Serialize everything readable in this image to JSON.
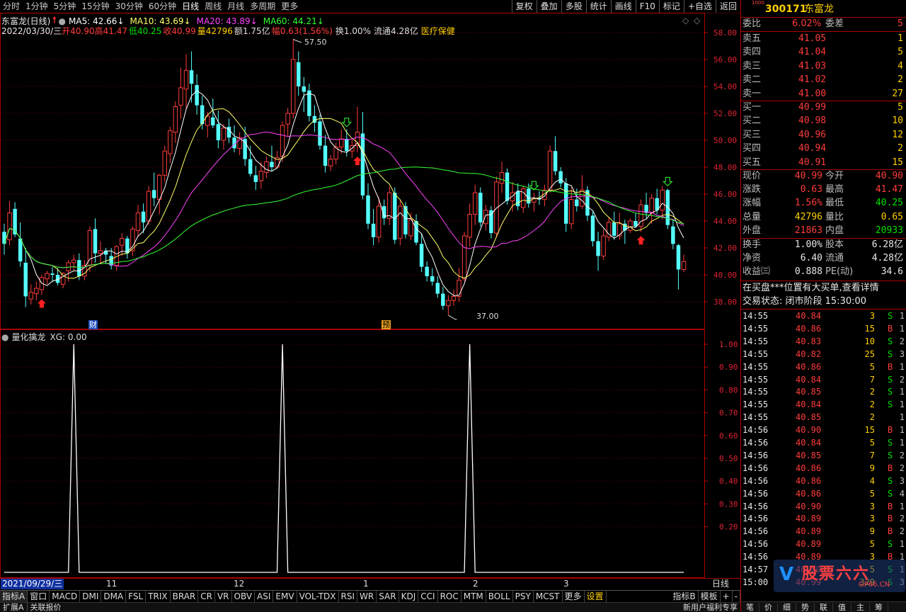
{
  "toolbar": {
    "periods": [
      "分时",
      "1分钟",
      "5分钟",
      "15分钟",
      "30分钟",
      "60分钟",
      "日线",
      "周线",
      "月线",
      "多周期",
      "更多"
    ],
    "active_period": "日线",
    "right_buttons": [
      "复权",
      "叠加",
      "多股",
      "统计",
      "画线",
      "F10",
      "标记",
      "+自选",
      "返回"
    ]
  },
  "stock": {
    "title": "东富龙(日线)",
    "code": "300171",
    "name": "东富龙",
    "code_badge": "1000"
  },
  "ma": {
    "ma5": "MA5: 42.66",
    "ma10": "MA10: 43.69",
    "ma20": "MA20: 43.89",
    "ma60": "MA60: 44.21",
    "colors": {
      "ma5": "#ffffff",
      "ma10": "#ffff66",
      "ma20": "#ff44ff",
      "ma60": "#33ff33"
    }
  },
  "bar_info": {
    "date": "2022/03/30/三",
    "open_label": "开",
    "open": "40.90",
    "high_label": "高",
    "high": "41.47",
    "low_label": "低",
    "low": "40.25",
    "close_label": "收",
    "close": "40.99",
    "volume_label": "量",
    "volume": "42796",
    "amount_label": "额",
    "amount": "1.75亿",
    "change_label": "幅",
    "change": "0.63(1.56%)",
    "turnover": "换1.00%",
    "float": "流通4.28亿",
    "sector": "医疗保健"
  },
  "price_axis": [
    "58.00",
    "56.00",
    "54.00",
    "52.00",
    "50.00",
    "48.00",
    "46.00",
    "44.00",
    "42.00",
    "40.00",
    "38.00"
  ],
  "annotations": {
    "high_mark": "57.50",
    "low_mark": "37.00",
    "fin_badge": "财",
    "pre_badge": "预"
  },
  "indicator": {
    "title": "量化擒龙",
    "value_label": "XG: 0.00",
    "axis": [
      "1.00",
      "0.90",
      "0.80",
      "0.70",
      "0.60",
      "0.50",
      "0.40",
      "0.30",
      "0.20"
    ]
  },
  "x_axis": {
    "start_date": "2021/09/29/三",
    "months": [
      "11",
      "12",
      "1",
      "2",
      "3"
    ],
    "period_label": "日线"
  },
  "indicator_tabs": [
    "指标A",
    "窗口",
    "MACD",
    "DMI",
    "DMA",
    "FSL",
    "TRIX",
    "BRAR",
    "CR",
    "VR",
    "OBV",
    "ASI",
    "EMV",
    "VOL-TDX",
    "RSI",
    "WR",
    "SAR",
    "KDJ",
    "CCI",
    "ROC",
    "MTM",
    "BOLL",
    "PSY",
    "MCST",
    "更多",
    "设置"
  ],
  "right_tabs": [
    "指标B",
    "模板",
    "+",
    "-"
  ],
  "quote": {
    "weibi_label": "委比",
    "weibi": "6.02%",
    "weicha_label": "委差",
    "weicha": "5",
    "sell": [
      {
        "label": "卖五",
        "price": "41.05",
        "vol": "1"
      },
      {
        "label": "卖四",
        "price": "41.04",
        "vol": "5"
      },
      {
        "label": "卖三",
        "price": "41.03",
        "vol": "4"
      },
      {
        "label": "卖二",
        "price": "41.02",
        "vol": "2"
      },
      {
        "label": "卖一",
        "price": "41.00",
        "vol": "27"
      }
    ],
    "buy": [
      {
        "label": "买一",
        "price": "40.99",
        "vol": "5"
      },
      {
        "label": "买二",
        "price": "40.98",
        "vol": "10"
      },
      {
        "label": "买三",
        "price": "40.96",
        "vol": "12"
      },
      {
        "label": "买四",
        "price": "40.94",
        "vol": "2"
      },
      {
        "label": "买五",
        "price": "40.91",
        "vol": "15"
      }
    ],
    "stats": [
      {
        "l1": "现价",
        "v1": "40.99",
        "l2": "今开",
        "v2": "40.90",
        "c1": "red",
        "c2": "red"
      },
      {
        "l1": "涨跌",
        "v1": "0.63",
        "l2": "最高",
        "v2": "41.47",
        "c1": "red",
        "c2": "red"
      },
      {
        "l1": "涨幅",
        "v1": "1.56%",
        "l2": "最低",
        "v2": "40.25",
        "c1": "red",
        "c2": "green"
      },
      {
        "l1": "总量",
        "v1": "42796",
        "l2": "量比",
        "v2": "0.65",
        "c1": "yellow",
        "c2": "yellow"
      },
      {
        "l1": "外盘",
        "v1": "21863",
        "l2": "内盘",
        "v2": "20933",
        "c1": "red",
        "c2": "green"
      }
    ],
    "stats2": [
      {
        "l1": "换手",
        "v1": "1.00%",
        "l2": "股本",
        "v2": "6.28亿"
      },
      {
        "l1": "净资",
        "v1": "6.40",
        "l2": "流通",
        "v2": "4.28亿"
      },
      {
        "l1": "收益㈢",
        "v1": "0.888",
        "l2": "PE(动)",
        "v2": "34.6"
      }
    ],
    "notice": "在买盘***位置有大买单,查看详情",
    "trade_status": "交易状态: 闭市阶段 15:30:00"
  },
  "ticks": [
    {
      "t": "14:55",
      "p": "40.84",
      "v": "3",
      "s": "S",
      "n": "1"
    },
    {
      "t": "14:55",
      "p": "40.86",
      "v": "15",
      "s": "B",
      "n": "1"
    },
    {
      "t": "14:55",
      "p": "40.83",
      "v": "10",
      "s": "S",
      "n": "2"
    },
    {
      "t": "14:55",
      "p": "40.82",
      "v": "25",
      "s": "S",
      "n": "3"
    },
    {
      "t": "14:55",
      "p": "40.86",
      "v": "5",
      "s": "B",
      "n": "1"
    },
    {
      "t": "14:55",
      "p": "40.84",
      "v": "7",
      "s": "S",
      "n": "2"
    },
    {
      "t": "14:55",
      "p": "40.85",
      "v": "2",
      "s": "S",
      "n": "1"
    },
    {
      "t": "14:55",
      "p": "40.84",
      "v": "2",
      "s": "S",
      "n": "1"
    },
    {
      "t": "14:55",
      "p": "40.85",
      "v": "2",
      "s": "",
      "n": "1"
    },
    {
      "t": "14:56",
      "p": "40.90",
      "v": "15",
      "s": "B",
      "n": "1"
    },
    {
      "t": "14:56",
      "p": "40.84",
      "v": "5",
      "s": "S",
      "n": "1"
    },
    {
      "t": "14:56",
      "p": "40.85",
      "v": "7",
      "s": "S",
      "n": "2"
    },
    {
      "t": "14:56",
      "p": "40.86",
      "v": "9",
      "s": "B",
      "n": "2"
    },
    {
      "t": "14:56",
      "p": "40.86",
      "v": "4",
      "s": "S",
      "n": "3"
    },
    {
      "t": "14:56",
      "p": "40.86",
      "v": "5",
      "s": "S",
      "n": "4"
    },
    {
      "t": "14:56",
      "p": "40.90",
      "v": "3",
      "s": "B",
      "n": "1"
    },
    {
      "t": "14:56",
      "p": "40.89",
      "v": "3",
      "s": "B",
      "n": "2"
    },
    {
      "t": "14:56",
      "p": "40.89",
      "v": "9",
      "s": "B",
      "n": "2"
    },
    {
      "t": "14:56",
      "p": "40.89",
      "v": "5",
      "s": "S",
      "n": "1"
    },
    {
      "t": "14:56",
      "p": "40.89",
      "v": "3",
      "s": "B",
      "n": "1"
    },
    {
      "t": "14:57",
      "p": "40.89",
      "v": "5",
      "s": "S",
      "n": "1"
    },
    {
      "t": "15:00",
      "p": "40.99",
      "v": "329",
      "s": "S",
      "n": "3"
    }
  ],
  "watermark": "GP66.CN",
  "status_bar": {
    "left": [
      "扩展A",
      "关联报价"
    ],
    "right": "新用户福利专享"
  },
  "right_bottom_tabs": [
    "笔",
    "价",
    "细",
    "势",
    "联",
    "值",
    "主",
    "筹"
  ],
  "candles": [
    [
      43.2,
      43.8,
      41.5,
      42.3
    ],
    [
      42.6,
      45.5,
      42.2,
      44.6
    ],
    [
      44.9,
      45.4,
      42.8,
      43.0
    ],
    [
      42.7,
      43.9,
      40.6,
      41.0
    ],
    [
      40.9,
      42.0,
      37.6,
      38.4
    ],
    [
      38.2,
      39.3,
      37.8,
      38.7
    ],
    [
      38.6,
      39.5,
      38.1,
      39.0
    ],
    [
      38.9,
      40.0,
      38.5,
      39.8
    ],
    [
      39.7,
      40.3,
      39.3,
      40.1
    ],
    [
      40.1,
      40.6,
      39.5,
      40.0
    ],
    [
      40.0,
      40.5,
      39.2,
      39.4
    ],
    [
      39.3,
      40.2,
      39.0,
      40.1
    ],
    [
      40.3,
      41.1,
      39.5,
      40.9
    ],
    [
      40.9,
      41.5,
      40.3,
      41.1
    ],
    [
      41.1,
      41.6,
      39.6,
      39.9
    ],
    [
      39.9,
      41.1,
      39.6,
      40.7
    ],
    [
      40.7,
      43.6,
      40.2,
      43.3
    ],
    [
      43.4,
      44.2,
      40.9,
      41.6
    ],
    [
      41.6,
      42.5,
      40.8,
      41.8
    ],
    [
      41.8,
      42.0,
      40.8,
      41.5
    ],
    [
      41.4,
      42.0,
      40.4,
      40.7
    ],
    [
      40.7,
      42.2,
      40.3,
      42.1
    ],
    [
      42.2,
      43.1,
      41.4,
      42.7
    ],
    [
      42.7,
      42.9,
      41.2,
      41.6
    ],
    [
      41.8,
      43.6,
      41.4,
      43.4
    ],
    [
      43.3,
      45.2,
      42.8,
      44.6
    ],
    [
      44.7,
      45.3,
      43.1,
      43.9
    ],
    [
      44.0,
      46.6,
      43.7,
      46.2
    ],
    [
      46.3,
      47.6,
      45.1,
      45.7
    ],
    [
      45.6,
      47.5,
      44.5,
      47.4
    ],
    [
      47.4,
      49.6,
      46.9,
      49.2
    ],
    [
      49.0,
      51.0,
      48.3,
      50.7
    ],
    [
      50.6,
      52.9,
      49.8,
      52.5
    ],
    [
      52.6,
      55.4,
      51.6,
      53.9
    ],
    [
      53.8,
      56.4,
      52.3,
      55.2
    ],
    [
      55.2,
      56.6,
      52.8,
      54.2
    ],
    [
      54.1,
      54.9,
      51.9,
      52.6
    ],
    [
      52.6,
      53.3,
      50.8,
      51.2
    ],
    [
      51.1,
      52.1,
      50.2,
      51.8
    ],
    [
      51.7,
      53.1,
      50.9,
      51.1
    ],
    [
      51.2,
      52.2,
      49.4,
      50.0
    ],
    [
      50.0,
      51.2,
      49.3,
      50.9
    ],
    [
      51.0,
      51.6,
      49.8,
      50.2
    ],
    [
      50.2,
      51.1,
      49.1,
      49.4
    ],
    [
      49.4,
      50.6,
      48.9,
      50.2
    ],
    [
      50.1,
      51.0,
      48.1,
      48.6
    ],
    [
      48.6,
      49.6,
      47.3,
      47.5
    ],
    [
      47.4,
      48.1,
      46.3,
      46.9
    ],
    [
      47.0,
      48.4,
      46.4,
      47.7
    ],
    [
      47.6,
      48.8,
      47.2,
      48.4
    ],
    [
      48.4,
      49.6,
      47.7,
      48.0
    ],
    [
      48.0,
      49.2,
      47.9,
      48.7
    ],
    [
      48.8,
      51.4,
      48.4,
      51.1
    ],
    [
      51.2,
      52.4,
      50.3,
      52.0
    ],
    [
      52.0,
      57.5,
      51.6,
      56.0
    ],
    [
      55.8,
      56.6,
      53.3,
      54.0
    ],
    [
      54.0,
      54.7,
      52.1,
      53.6
    ],
    [
      53.7,
      54.2,
      51.4,
      51.8
    ],
    [
      51.8,
      52.6,
      50.6,
      51.3
    ],
    [
      51.4,
      51.9,
      49.3,
      49.6
    ],
    [
      49.6,
      50.4,
      47.6,
      48.1
    ],
    [
      48.1,
      48.9,
      47.7,
      48.6
    ],
    [
      48.6,
      49.8,
      48.2,
      49.5
    ],
    [
      49.5,
      50.8,
      49.0,
      50.1
    ],
    [
      50.1,
      50.8,
      48.8,
      49.2
    ],
    [
      49.2,
      50.0,
      48.7,
      49.6
    ],
    [
      49.6,
      52.5,
      49.1,
      50.6
    ],
    [
      50.5,
      52.1,
      45.6,
      45.9
    ],
    [
      45.9,
      46.8,
      43.4,
      43.8
    ],
    [
      43.8,
      44.9,
      42.2,
      42.8
    ],
    [
      42.8,
      45.8,
      42.4,
      45.1
    ],
    [
      45.1,
      45.6,
      43.7,
      44.2
    ],
    [
      44.2,
      46.6,
      43.7,
      46.1
    ],
    [
      46.1,
      46.5,
      42.3,
      42.6
    ],
    [
      42.7,
      45.6,
      42.2,
      45.1
    ],
    [
      45.1,
      45.4,
      42.7,
      43.0
    ],
    [
      42.9,
      44.6,
      42.6,
      44.1
    ],
    [
      44.0,
      44.5,
      42.2,
      42.4
    ],
    [
      42.3,
      43.1,
      40.2,
      40.6
    ],
    [
      40.6,
      41.0,
      39.5,
      39.9
    ],
    [
      39.9,
      40.5,
      39.2,
      39.5
    ],
    [
      39.4,
      39.9,
      38.3,
      38.6
    ],
    [
      38.6,
      39.1,
      37.4,
      37.7
    ],
    [
      37.7,
      38.5,
      37.0,
      38.1
    ],
    [
      38.1,
      38.9,
      37.7,
      38.4
    ],
    [
      38.4,
      40.5,
      38.0,
      39.6
    ],
    [
      39.7,
      43.2,
      39.5,
      42.9
    ],
    [
      42.8,
      45.3,
      42.1,
      44.5
    ],
    [
      44.5,
      46.7,
      43.7,
      46.1
    ],
    [
      46.1,
      46.5,
      43.6,
      43.9
    ],
    [
      43.8,
      45.2,
      43.3,
      44.8
    ],
    [
      44.8,
      45.1,
      42.7,
      43.1
    ],
    [
      43.1,
      47.3,
      42.8,
      46.9
    ],
    [
      46.8,
      48.4,
      46.1,
      47.6
    ],
    [
      47.6,
      47.9,
      45.2,
      45.5
    ],
    [
      45.5,
      46.9,
      44.7,
      46.1
    ],
    [
      46.2,
      46.8,
      44.8,
      45.1
    ],
    [
      45.0,
      46.6,
      44.6,
      46.4
    ],
    [
      46.4,
      46.8,
      45.0,
      45.3
    ],
    [
      45.4,
      46.1,
      44.7,
      45.7
    ],
    [
      45.7,
      46.2,
      45.2,
      45.6
    ],
    [
      45.6,
      46.7,
      45.1,
      46.3
    ],
    [
      46.3,
      49.6,
      46.1,
      49.2
    ],
    [
      49.2,
      50.3,
      47.4,
      47.7
    ],
    [
      47.7,
      48.0,
      46.5,
      46.8
    ],
    [
      46.8,
      47.2,
      43.2,
      43.8
    ],
    [
      43.8,
      46.5,
      43.4,
      45.6
    ],
    [
      45.6,
      46.4,
      44.7,
      45.1
    ],
    [
      45.1,
      47.4,
      44.9,
      46.3
    ],
    [
      46.3,
      46.6,
      44.0,
      44.4
    ],
    [
      44.4,
      44.7,
      42.1,
      42.5
    ],
    [
      42.5,
      43.2,
      40.3,
      41.4
    ],
    [
      41.4,
      43.4,
      41.1,
      42.9
    ],
    [
      42.8,
      44.3,
      42.5,
      43.9
    ],
    [
      43.9,
      44.7,
      42.6,
      42.9
    ],
    [
      42.9,
      44.6,
      42.6,
      43.8
    ],
    [
      43.8,
      44.1,
      42.3,
      43.3
    ],
    [
      43.3,
      44.2,
      43.1,
      44.0
    ],
    [
      44.0,
      44.6,
      43.5,
      43.6
    ],
    [
      43.6,
      45.6,
      43.2,
      45.2
    ],
    [
      45.2,
      46.1,
      44.2,
      44.6
    ],
    [
      44.6,
      46.0,
      43.8,
      45.7
    ],
    [
      45.7,
      46.4,
      44.5,
      44.8
    ],
    [
      44.8,
      46.6,
      44.1,
      46.3
    ],
    [
      46.3,
      46.4,
      43.4,
      43.7
    ],
    [
      43.6,
      44.1,
      41.9,
      42.3
    ],
    [
      42.2,
      42.3,
      38.9,
      40.4
    ],
    [
      40.4,
      41.5,
      40.2,
      40.99
    ]
  ],
  "signals": [
    {
      "type": "up",
      "i": 7
    },
    {
      "type": "up",
      "i": 66
    },
    {
      "type": "down",
      "i": 99
    },
    {
      "type": "up",
      "i": 119
    },
    {
      "type": "down",
      "i": 124
    },
    {
      "type": "down",
      "i": 64
    }
  ],
  "xg_spikes": [
    13,
    52,
    87
  ]
}
